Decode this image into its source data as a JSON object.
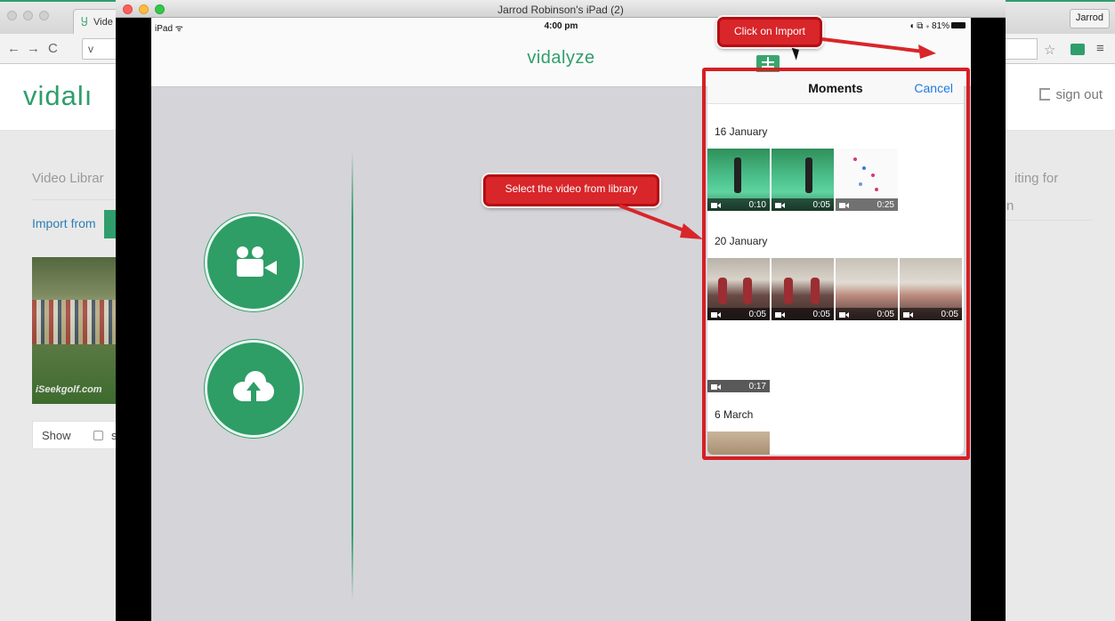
{
  "browser": {
    "tab_title": "Vide",
    "profile": "Jarrod",
    "url_partial": "v"
  },
  "site": {
    "logo": "vidalı",
    "sign_out": "sign out",
    "video_library": "Video Librar",
    "import_from": "Import from",
    "thumb_watermark": "iSeekgolf.com",
    "show_label": "Show",
    "show_s": "s",
    "waiting_1": "iting for",
    "waiting_2": "n"
  },
  "mirror": {
    "window_title": "Jarrod Robinson's iPad (2)"
  },
  "ios": {
    "device": "iPad ᯤ",
    "time": "4:00 pm",
    "battery": "◖ ⧉ ∗ 81%",
    "app_logo": "vidalyze"
  },
  "popover": {
    "title": "Moments",
    "cancel": "Cancel",
    "moments": [
      {
        "date": "16 January",
        "durations": [
          "0:10",
          "0:05",
          "0:25"
        ]
      },
      {
        "date": "20 January",
        "durations": [
          "0:05",
          "0:05",
          "0:05",
          "0:05",
          "0:17"
        ]
      },
      {
        "date": "6 March",
        "durations": []
      }
    ]
  },
  "annotations": {
    "click_import": "Click on Import",
    "select_video": "Select the video from library"
  },
  "colors": {
    "brand_green": "#2f9e6b",
    "annotation_red": "#d8262a",
    "ios_link_blue": "#1f7ae0"
  }
}
